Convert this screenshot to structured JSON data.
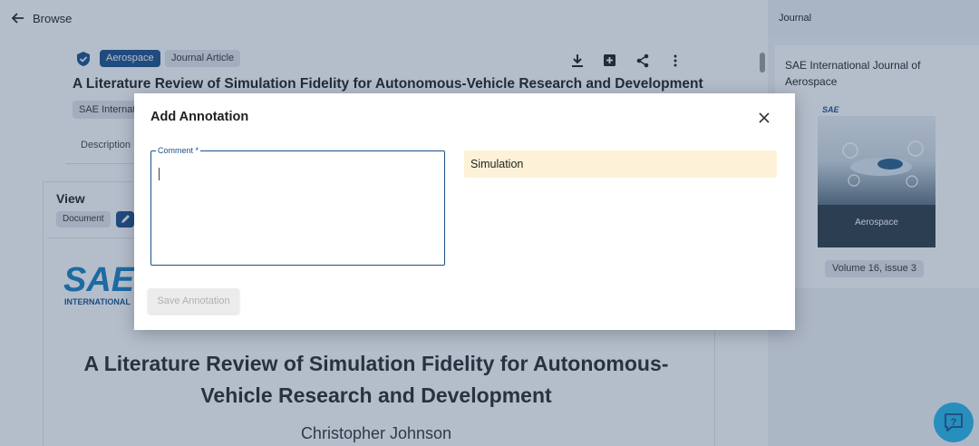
{
  "topbar": {
    "back_label": "Browse"
  },
  "article": {
    "tags": [
      "Aerospace",
      "Journal Article"
    ],
    "title": "A Literature Review of Simulation Fidelity for Autonomous-Vehicle Research and Development",
    "publisher_chip": "SAE International",
    "tab_description": "Description"
  },
  "view": {
    "heading": "View",
    "doc_chip": "Document",
    "logo_text": "INTERNATIONAL",
    "paper_title": "A Literature Review of Simulation Fidelity for Autonomous-Vehicle Research and Development",
    "author": "Christopher Johnson"
  },
  "sidebar": {
    "header": "Journal",
    "journal_name": "SAE International Journal of Aerospace",
    "cover_logo": "SAE",
    "cover_title": "Aerospace",
    "volume_issue": "Volume 16, issue 3"
  },
  "dialog": {
    "title": "Add Annotation",
    "comment_label": "Comment *",
    "comment_value": "",
    "highlighted_text": "Simulation",
    "save_button": "Save Annotation"
  },
  "colors": {
    "accent": "#1c4f8a",
    "highlight": "#fdf2d8",
    "help": "#29b6e8"
  }
}
